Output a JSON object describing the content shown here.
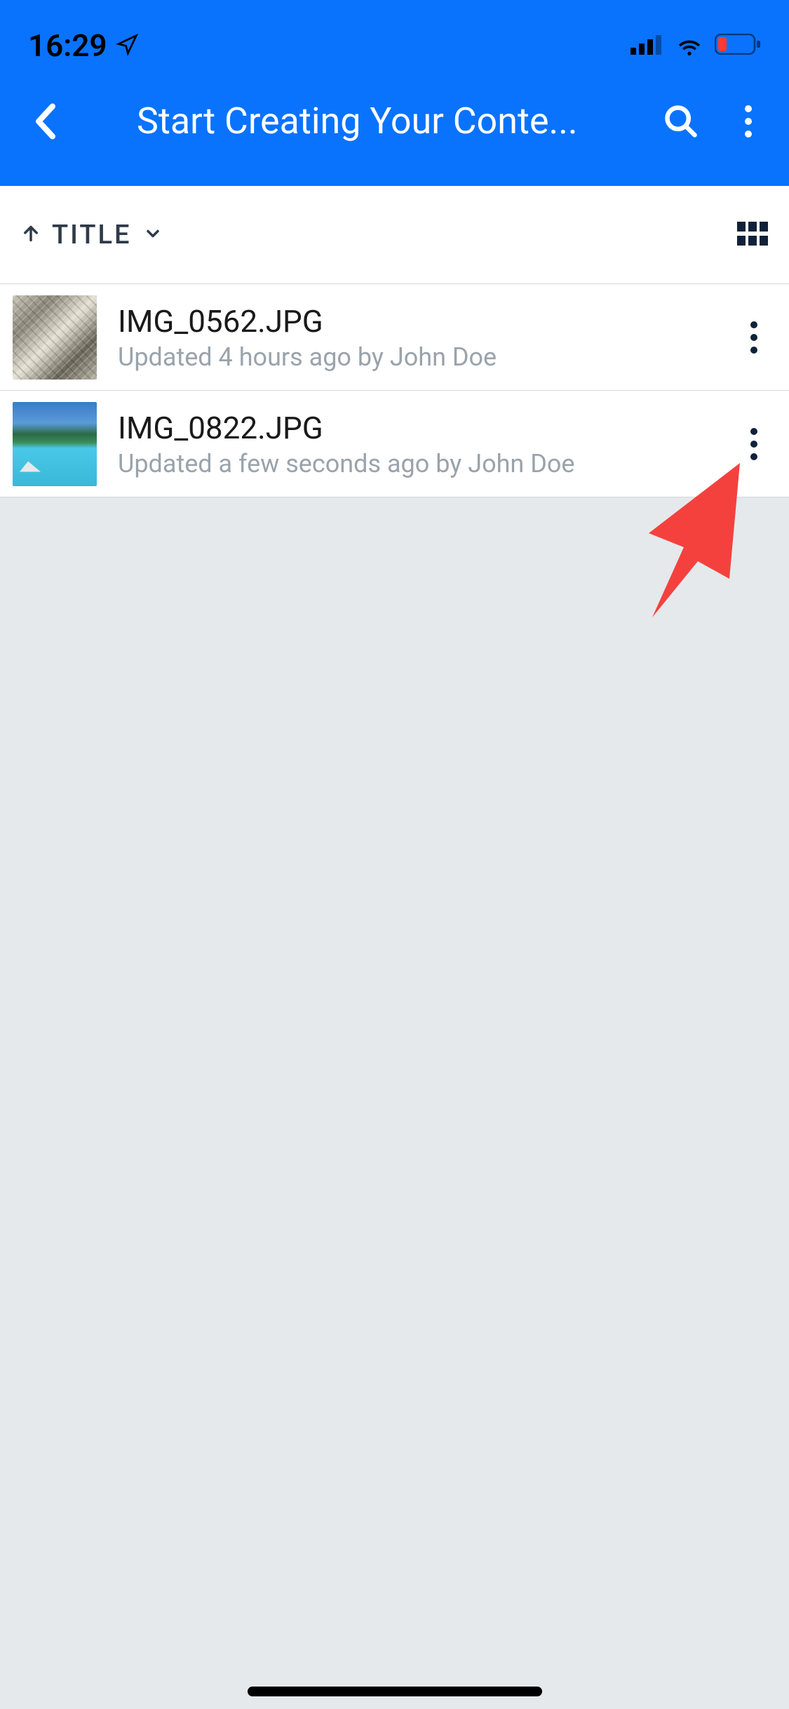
{
  "status": {
    "time": "16:29"
  },
  "header": {
    "title": "Start Creating Your Conte..."
  },
  "sort": {
    "label": "TITLE"
  },
  "files": [
    {
      "name": "IMG_0562.JPG",
      "meta": "Updated 4 hours ago by John Doe"
    },
    {
      "name": "IMG_0822.JPG",
      "meta": "Updated a few seconds ago by John Doe"
    }
  ]
}
